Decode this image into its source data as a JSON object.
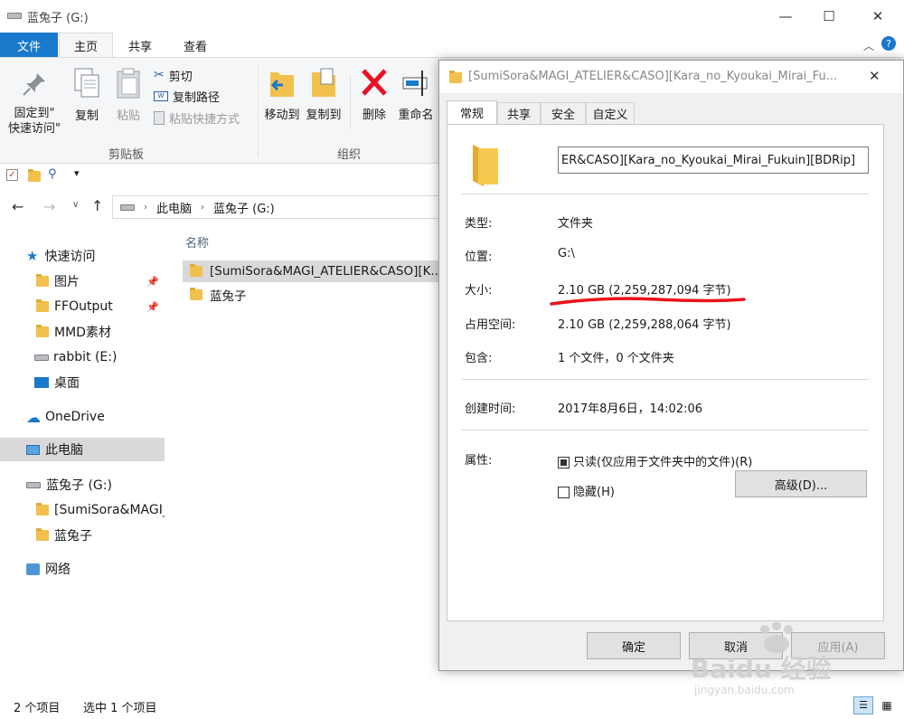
{
  "window": {
    "title": "蓝兔子 (G:)"
  },
  "ribbon_tabs": {
    "file": "文件",
    "home": "主页",
    "share": "共享",
    "view": "查看"
  },
  "ribbon": {
    "pin_quick_access": "固定到\"\n快速访问\"",
    "copy": "复制",
    "paste": "粘贴",
    "cut": "剪切",
    "copy_path": "复制路径",
    "paste_shortcut": "粘贴快捷方式",
    "clipboard_group": "剪贴板",
    "move_to": "移动到",
    "copy_to": "复制到",
    "delete": "删除",
    "rename": "重命名",
    "organize_group": "组织"
  },
  "address": {
    "crumb1": "此电脑",
    "crumb2": "蓝兔子 (G:)"
  },
  "nav": {
    "quick_access": "快速访问",
    "pictures": "图片",
    "ffoutput": "FFOutput",
    "mmd": "MMD素材",
    "rabbit": "rabbit (E:)",
    "desktop": "桌面",
    "onedrive": "OneDrive",
    "this_pc": "此电脑",
    "drive_g": "蓝兔子 (G:)",
    "sub1": "[SumiSora&MAGI_",
    "sub2": "蓝兔子",
    "network": "网络"
  },
  "content": {
    "column_name": "名称",
    "rows": [
      "[SumiSora&MAGI_ATELIER&CASO][K...",
      "蓝兔子"
    ]
  },
  "status": {
    "count": "2 个项目",
    "selected": "选中 1 个项目"
  },
  "dialog": {
    "title": "[SumiSora&MAGI_ATELIER&CASO][Kara_no_Kyoukai_Mirai_Fu...",
    "tabs": [
      "常规",
      "共享",
      "安全",
      "自定义"
    ],
    "name_value": "ER&CASO][Kara_no_Kyoukai_Mirai_Fukuin][BDRip]",
    "type_label": "类型:",
    "type_value": "文件夹",
    "location_label": "位置:",
    "location_value": "G:\\",
    "size_label": "大小:",
    "size_value": "2.10 GB (2,259,287,094 字节)",
    "disk_label": "占用空间:",
    "disk_value": "2.10 GB (2,259,288,064 字节)",
    "contains_label": "包含:",
    "contains_value": "1 个文件，0 个文件夹",
    "created_label": "创建时间:",
    "created_value": "2017年8月6日，14:02:06",
    "attr_label": "属性:",
    "readonly_label": "只读(仅应用于文件夹中的文件)(R)",
    "hidden_label": "隐藏(H)",
    "advanced": "高级(D)...",
    "ok": "确定",
    "cancel": "取消",
    "apply": "应用(A)"
  },
  "watermark": {
    "brand": "Baidu 经验",
    "url": "jingyan.baidu.com"
  },
  "colors": {
    "accent": "#1979ca",
    "underline": "#e8141c"
  }
}
